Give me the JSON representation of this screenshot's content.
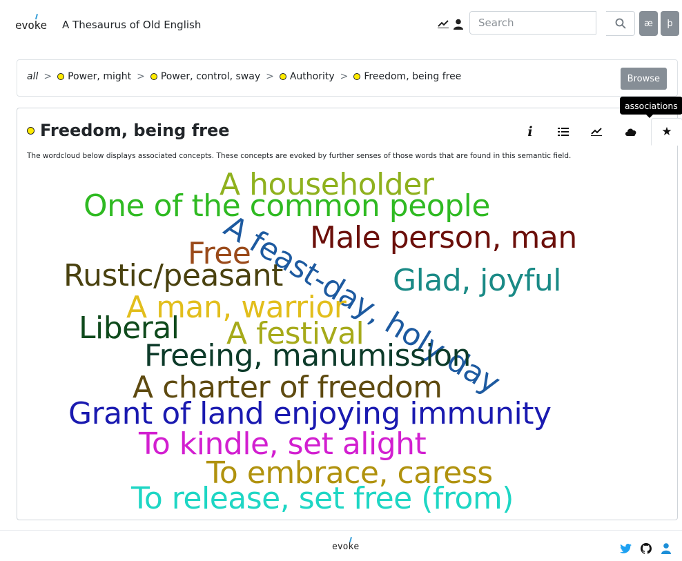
{
  "header": {
    "logo": "evoke",
    "title": "A Thesaurus of Old English",
    "search_placeholder": "Search",
    "char_buttons": [
      "æ",
      "þ"
    ]
  },
  "breadcrumb": {
    "root": "all",
    "items": [
      "Power, might",
      "Power, control, sway",
      "Authority",
      "Freedom, being free"
    ],
    "browse_label": "Browse"
  },
  "card": {
    "title": "Freedom, being free",
    "description": "The wordcloud below displays associated concepts. These concepts are evoked by further senses of those words that are found in this semantic field.",
    "tabs": [
      {
        "icon": "info-icon",
        "glyph": "𝑖"
      },
      {
        "icon": "list-icon",
        "glyph": "≣"
      },
      {
        "icon": "chart-icon",
        "glyph": ""
      },
      {
        "icon": "cloud-icon",
        "glyph": ""
      },
      {
        "icon": "star-icon",
        "glyph": "★"
      }
    ],
    "active_tab": 4,
    "tooltip": "associations"
  },
  "wordcloud": [
    {
      "text": "A householder",
      "color": "#8fb11e"
    },
    {
      "text": "One of the common people",
      "color": "#2fba22"
    },
    {
      "text": "Male person, man",
      "color": "#6b0f0a"
    },
    {
      "text": "Free",
      "color": "#9a4a1a"
    },
    {
      "text": "A feast-day, holy day",
      "color": "#1d5aa0"
    },
    {
      "text": "Rustic/peasant",
      "color": "#4a4210"
    },
    {
      "text": "Glad, joyful",
      "color": "#1a8a86"
    },
    {
      "text": "A man, warrior",
      "color": "#e2be1c"
    },
    {
      "text": "Liberal",
      "color": "#0f4a1c"
    },
    {
      "text": "A festival",
      "color": "#a6aa1a"
    },
    {
      "text": "Freeing, manumission",
      "color": "#0d3b2a"
    },
    {
      "text": "A charter of freedom",
      "color": "#5e4a10"
    },
    {
      "text": "Grant of land enjoying immunity",
      "color": "#1a1ab0"
    },
    {
      "text": "To kindle, set alight",
      "color": "#d21fd0"
    },
    {
      "text": "To embrace, caress",
      "color": "#b0920e"
    },
    {
      "text": "To release, set free (from)",
      "color": "#1ed6c4"
    }
  ],
  "footer": {
    "logo": "evoke"
  }
}
